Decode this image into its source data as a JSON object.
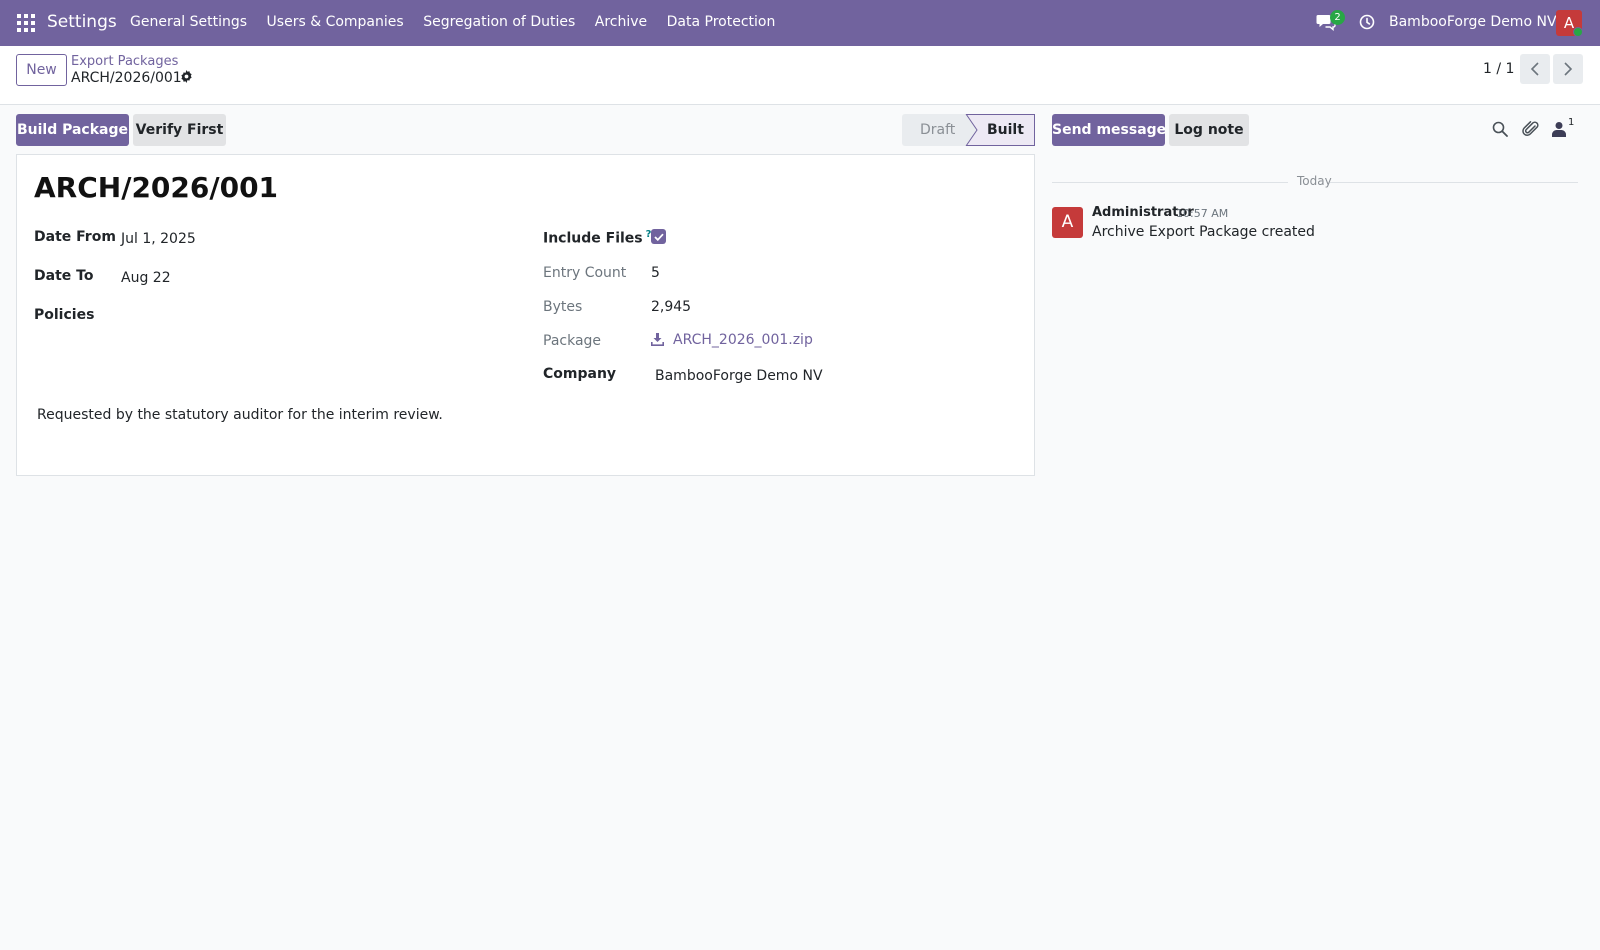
{
  "navbar": {
    "app_name": "Settings",
    "menu": [
      "General Settings",
      "Users & Companies",
      "Segregation of Duties",
      "Archive",
      "Data Protection"
    ],
    "chat_badge": "2",
    "company": "BambooForge Demo NV",
    "user_initial": "A",
    "accent_color": "#71639e"
  },
  "control_panel": {
    "new_label": "New",
    "breadcrumb_parent": "Export Packages",
    "breadcrumb_current": "ARCH/2026/001",
    "pager": "1 / 1"
  },
  "statusbar": {
    "build_label": "Build Package",
    "verify_label": "Verify First",
    "stages": [
      "Draft",
      "Built"
    ],
    "current_stage": "Built"
  },
  "form": {
    "title": "ARCH/2026/001",
    "date_from_label": "Date From",
    "date_from": "Jul 1, 2025",
    "date_to_label": "Date To",
    "date_to": "Aug 22",
    "policies_label": "Policies",
    "include_files_label": "Include Files",
    "include_files_help": "?",
    "include_files": true,
    "entry_count_label": "Entry Count",
    "entry_count": "5",
    "bytes_label": "Bytes",
    "bytes": "2,945",
    "package_label": "Package",
    "package_file": "ARCH_2026_001.zip",
    "company_label": "Company",
    "company": "BambooForge Demo NV",
    "note": "Requested by the statutory auditor for the interim review."
  },
  "chatter": {
    "send_message_label": "Send message",
    "log_note_label": "Log note",
    "followers_count": "1",
    "date_separator": "Today",
    "messages": [
      {
        "avatar_initial": "A",
        "author": "Administrator",
        "time": "10:57 AM",
        "body": "Archive Export Package created"
      }
    ]
  }
}
